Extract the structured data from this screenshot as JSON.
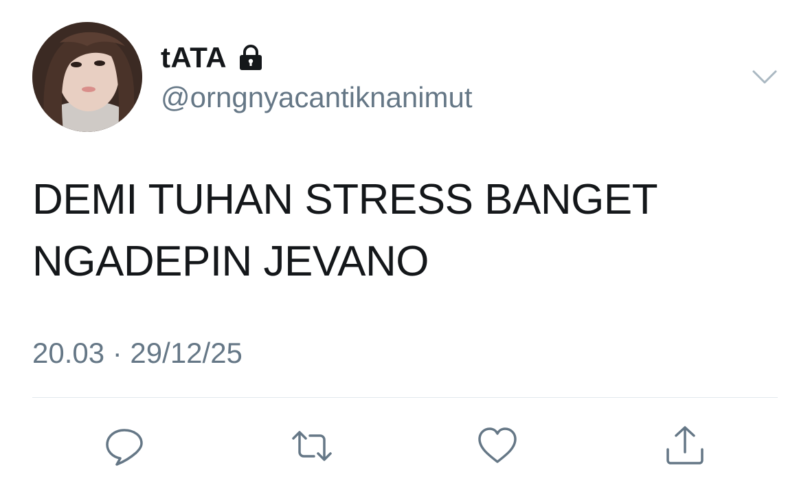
{
  "tweet": {
    "display_name": "tATA",
    "handle": "@orngnyacantiknanimut",
    "text_lines": [
      "DEMI TUHAN STRESS BANGET",
      "NGADEPIN JEVANO"
    ],
    "timestamp": "20.03 · 29/12/25"
  },
  "icons": {
    "lock": "lock-icon",
    "menu": "chevron-down-icon",
    "reply": "reply-icon",
    "retweet": "retweet-icon",
    "like": "heart-icon",
    "share": "share-icon"
  },
  "colors": {
    "text": "#14171a",
    "secondary": "#657786",
    "divider": "#e1e8ed",
    "icon": "#657786",
    "background": "#ffffff"
  }
}
